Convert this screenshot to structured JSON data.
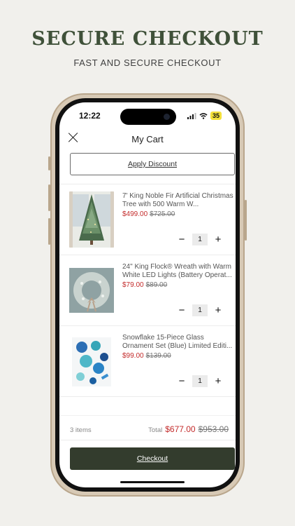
{
  "promo": {
    "title": "SECURE CHECKOUT",
    "subtitle": "FAST AND SECURE CHECKOUT"
  },
  "status_bar": {
    "time": "12:22",
    "battery": "35"
  },
  "header": {
    "title": "My Cart",
    "close_icon": "close-icon"
  },
  "discount_label": "Apply Discount",
  "items": [
    {
      "name": "7' King Noble Fir Artificial Christmas Tree with 500 Warm W...",
      "price": "$499.00",
      "original_price": "$725.00",
      "quantity": "1",
      "image": "christmas-tree-image"
    },
    {
      "name": "24\" King Flock® Wreath with Warm White LED Lights (Battery Operat...",
      "price": "$79.00",
      "original_price": "$89.00",
      "quantity": "1",
      "image": "wreath-image"
    },
    {
      "name": "Snowflake 15-Piece Glass Ornament Set (Blue) Limited Editi...",
      "price": "$99.00",
      "original_price": "$139.00",
      "quantity": "1",
      "image": "ornaments-image"
    }
  ],
  "qty_controls": {
    "minus": "−",
    "plus": "+"
  },
  "summary": {
    "item_count": "3 items",
    "total_label": "Total",
    "total": "$677.00",
    "original_total": "$953.00"
  },
  "checkout_label": "Checkout",
  "colors": {
    "background": "#f1f0ec",
    "brand_green": "#333c2d",
    "sale_red": "#c32b2b"
  }
}
